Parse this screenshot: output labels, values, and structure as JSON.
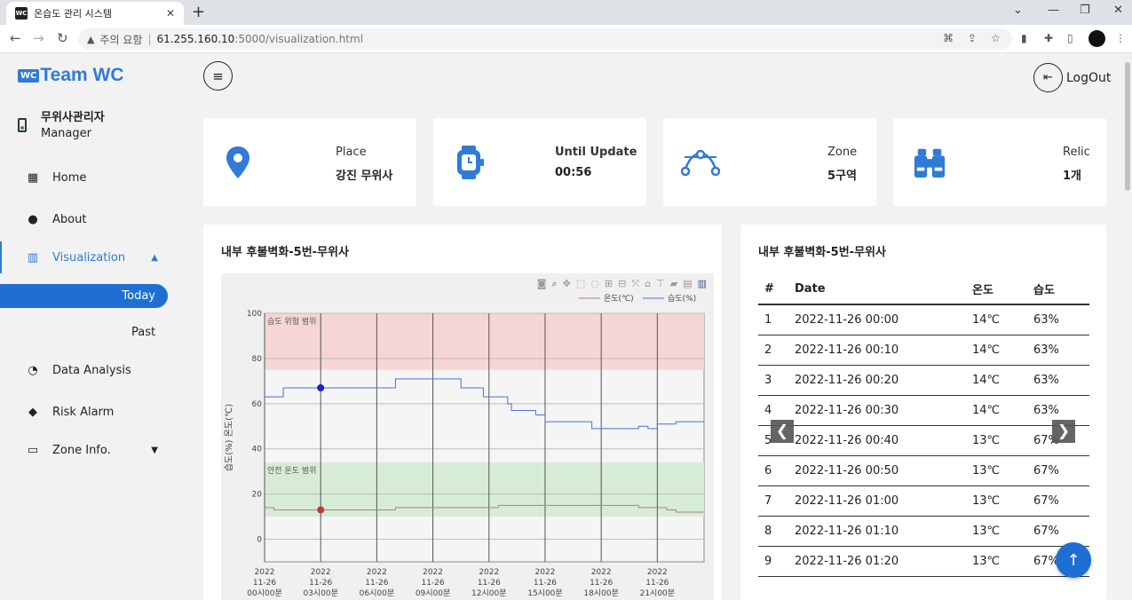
{
  "browser": {
    "tab_title": "온습도 관리 시스템",
    "tab_favicon": "WC",
    "security_label": "주의 요함",
    "url_host": "61.255.160.10",
    "url_path": ":5000/visualization.html"
  },
  "sidebar": {
    "logo_badge": "WC",
    "logo_text": "Team WC",
    "user_name": "무위사관리자",
    "user_role": "Manager",
    "items": [
      {
        "label": "Home",
        "icon": "grid-icon"
      },
      {
        "label": "About",
        "icon": "chat-icon"
      },
      {
        "label": "Visualization",
        "icon": "chart-icon"
      },
      {
        "label": "Data Analysis",
        "icon": "gauge-icon"
      },
      {
        "label": "Risk Alarm",
        "icon": "alert-icon"
      },
      {
        "label": "Zone Info.",
        "icon": "laptop-icon"
      }
    ],
    "sub_today": "Today",
    "sub_past": "Past"
  },
  "header": {
    "logout_label": "LogOut"
  },
  "cards": [
    {
      "label": "Place",
      "value": "강진 무위사",
      "icon": "location-pin-icon"
    },
    {
      "label": "Until Update",
      "value": "00:56",
      "icon": "smartwatch-icon"
    },
    {
      "label": "Zone",
      "value": "5구역",
      "icon": "vector-path-icon"
    },
    {
      "label": "Relic",
      "value": "1개",
      "icon": "binoculars-icon"
    }
  ],
  "chart_panel": {
    "title": "내부 후불벽화-5번-무위사"
  },
  "table_panel": {
    "title": "내부 후불벽화-5번-무위사",
    "columns": [
      "#",
      "Date",
      "온도",
      "습도"
    ],
    "rows": [
      [
        "1",
        "2022-11-26 00:00",
        "14℃",
        "63%"
      ],
      [
        "2",
        "2022-11-26 00:10",
        "14℃",
        "63%"
      ],
      [
        "3",
        "2022-11-26 00:20",
        "14℃",
        "63%"
      ],
      [
        "4",
        "2022-11-26 00:30",
        "14℃",
        "63%"
      ],
      [
        "5",
        "2022-11-26 00:40",
        "13℃",
        "67%"
      ],
      [
        "6",
        "2022-11-26 00:50",
        "13℃",
        "67%"
      ],
      [
        "7",
        "2022-11-26 01:00",
        "13℃",
        "67%"
      ],
      [
        "8",
        "2022-11-26 01:10",
        "13℃",
        "67%"
      ],
      [
        "9",
        "2022-11-26 01:20",
        "13℃",
        "67%"
      ]
    ]
  },
  "colors": {
    "accent": "#2f7bd6",
    "humidity_line": "#4a72d8",
    "temperature_line": "#b08080",
    "danger_band": "#f5d5d5",
    "safe_band": "#d7ecd7"
  },
  "chart_data": {
    "type": "line",
    "ylabel": "습도(%) 온도(℃)",
    "ylim": [
      -10,
      100
    ],
    "yticks": [
      0,
      20,
      40,
      60,
      80,
      100
    ],
    "xlim": [
      0,
      23.5
    ],
    "xticks": [
      {
        "x": 0,
        "lines": [
          "2022",
          "11-26",
          "00시00분"
        ]
      },
      {
        "x": 3,
        "lines": [
          "2022",
          "11-26",
          "03시00분"
        ]
      },
      {
        "x": 6,
        "lines": [
          "2022",
          "11-26",
          "06시00분"
        ]
      },
      {
        "x": 9,
        "lines": [
          "2022",
          "11-26",
          "09시00분"
        ]
      },
      {
        "x": 12,
        "lines": [
          "2022",
          "11-26",
          "12시00분"
        ]
      },
      {
        "x": 15,
        "lines": [
          "2022",
          "11-26",
          "15시00분"
        ]
      },
      {
        "x": 18,
        "lines": [
          "2022",
          "11-26",
          "18시00분"
        ]
      },
      {
        "x": 21,
        "lines": [
          "2022",
          "11-26",
          "21시00분"
        ]
      }
    ],
    "bands": [
      {
        "label": "습도 위험 범위",
        "y0": 75,
        "y1": 100,
        "color": "#f5d5d5"
      },
      {
        "label": "안전 온도 범위",
        "y0": 10,
        "y1": 34,
        "color": "#d7ecd7"
      }
    ],
    "legend_position": "top-right",
    "series": [
      {
        "name": "온도(℃)",
        "color": "#b08080",
        "x": [
          0,
          0.5,
          1,
          3,
          4,
          6.5,
          7,
          12,
          12.5,
          18,
          20,
          20.5,
          21.5,
          22,
          23.5
        ],
        "y": [
          14,
          13,
          13,
          13,
          13,
          13,
          14,
          14,
          15,
          15,
          14,
          14,
          13,
          12,
          12
        ],
        "markers": [
          {
            "x": 3,
            "y": 13
          }
        ]
      },
      {
        "name": "습도(%)",
        "color": "#4a72d8",
        "x": [
          0,
          0.5,
          1,
          3,
          5,
          6.5,
          7,
          8,
          9,
          10.3,
          10.5,
          11.7,
          12.5,
          13,
          13.2,
          14.5,
          15,
          17,
          17.5,
          19.3,
          20,
          20.5,
          21,
          22,
          23.5
        ],
        "y": [
          63,
          63,
          67,
          67,
          67,
          67,
          71,
          71,
          71,
          71,
          67,
          63,
          63,
          60,
          57,
          55,
          52,
          52,
          49,
          49,
          50,
          49,
          51,
          52,
          52
        ],
        "markers": [
          {
            "x": 3,
            "y": 67
          }
        ]
      }
    ]
  }
}
